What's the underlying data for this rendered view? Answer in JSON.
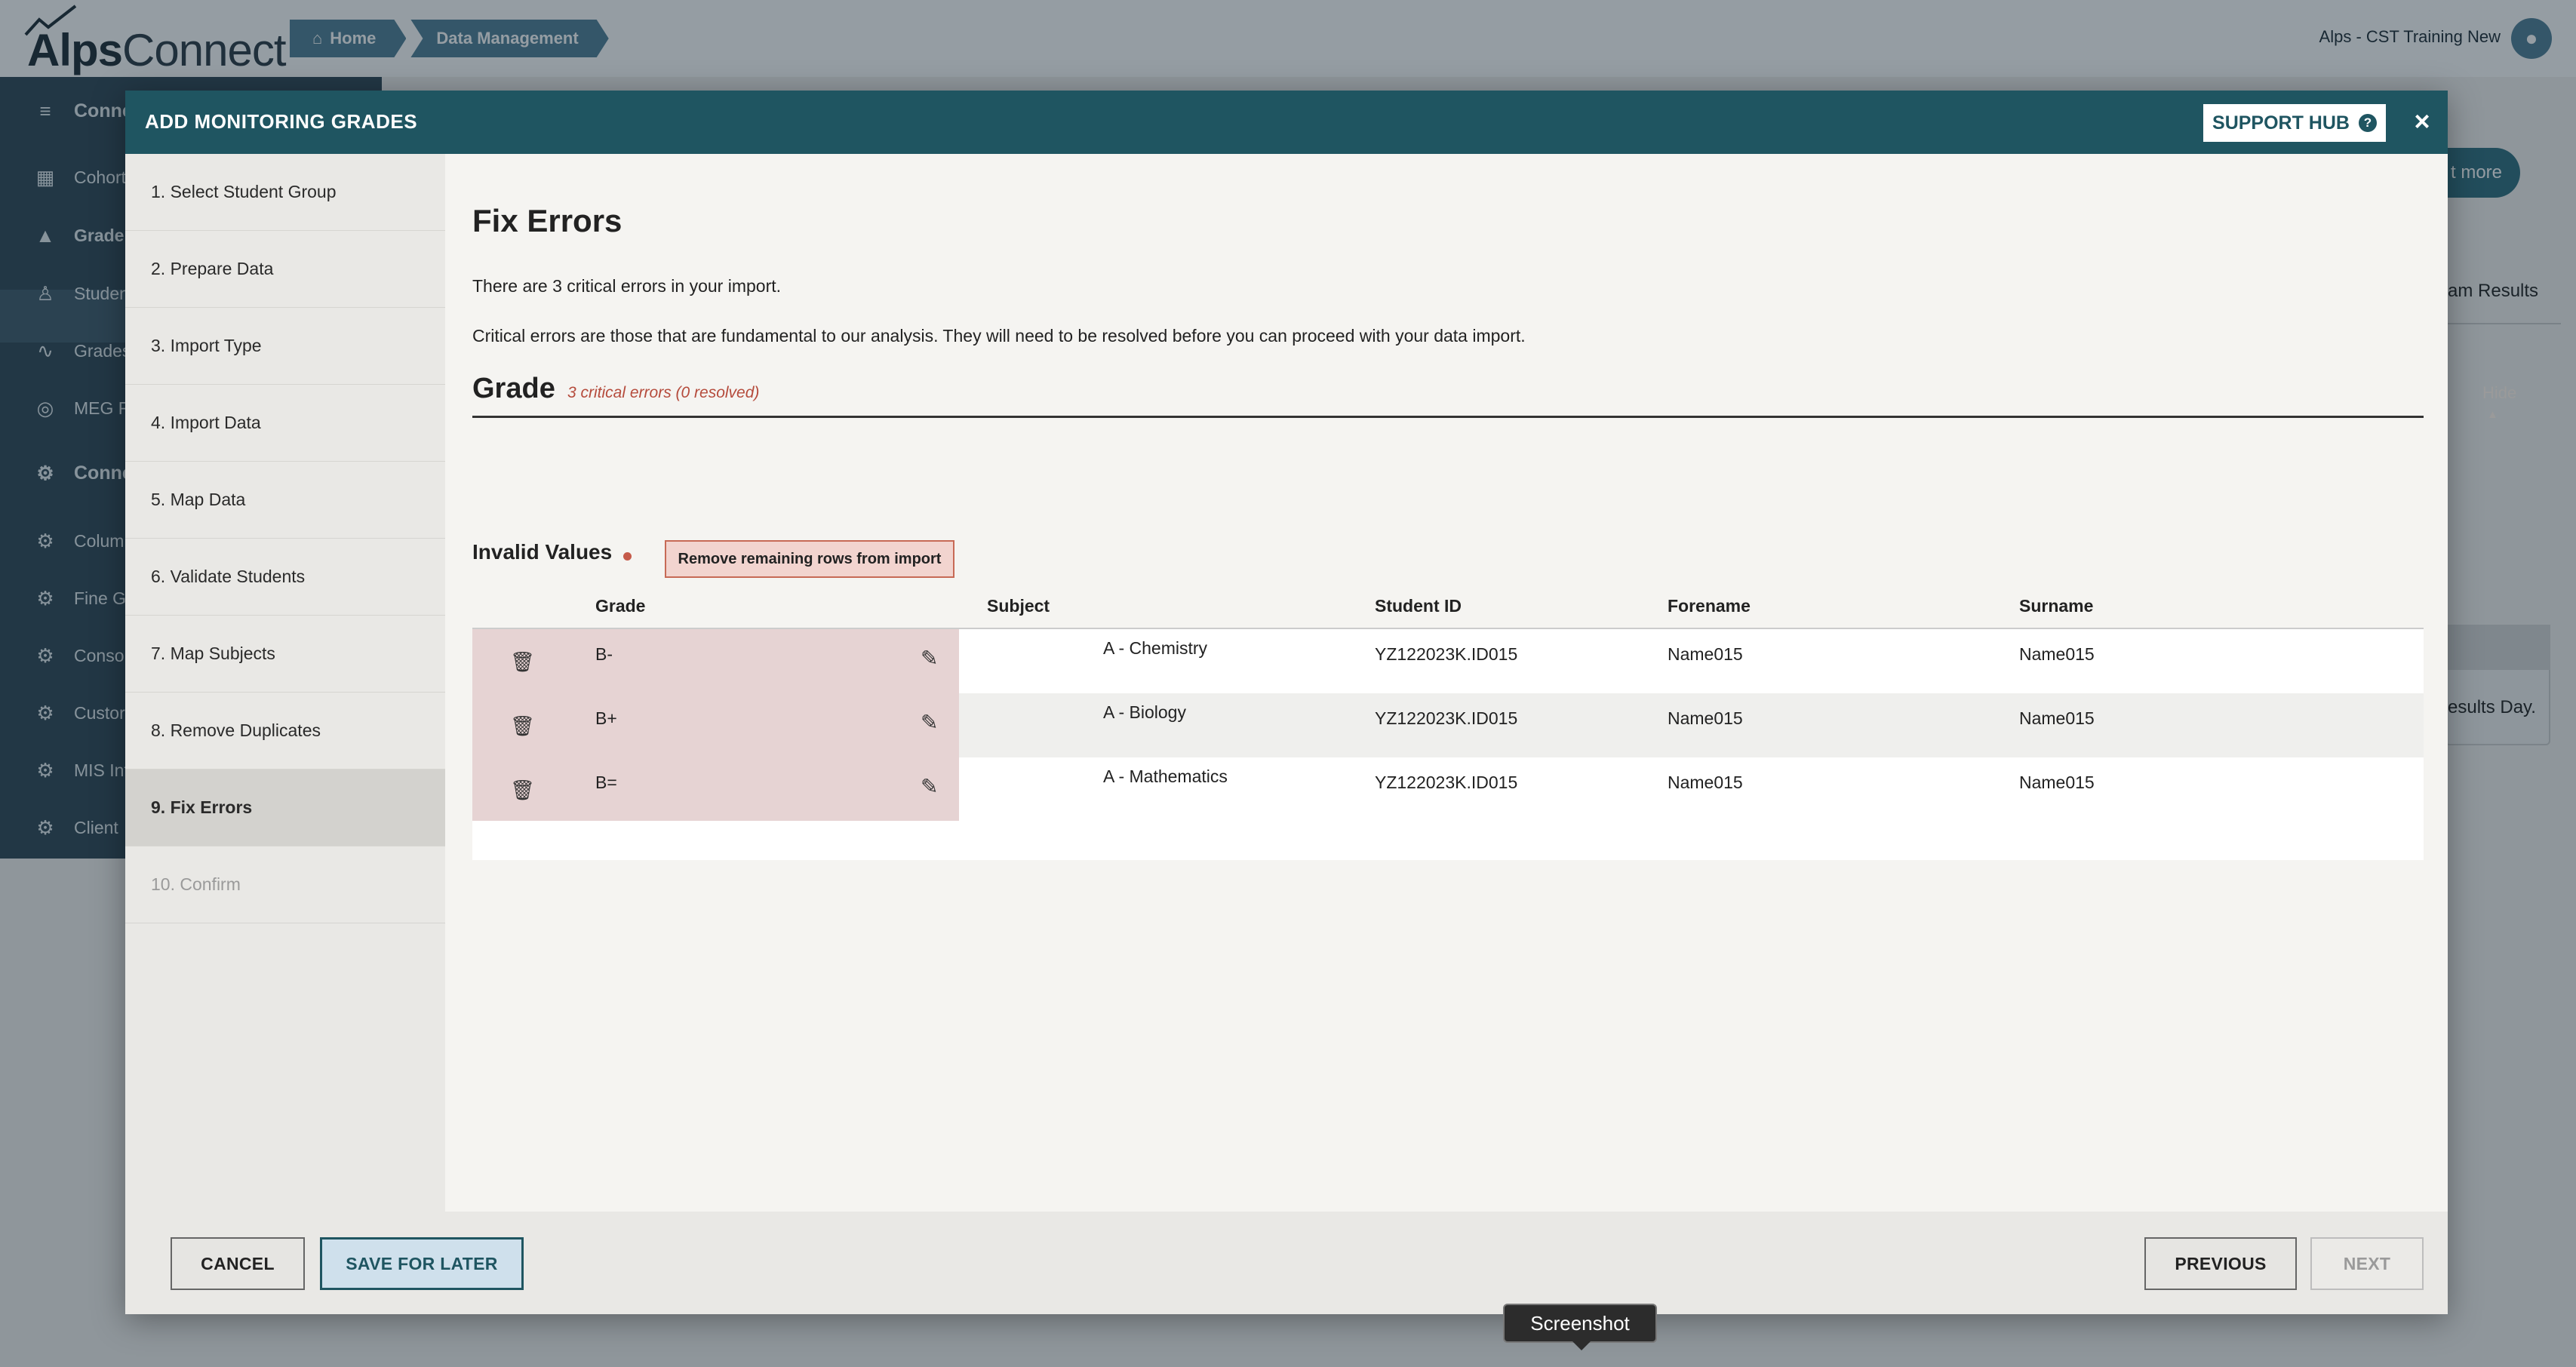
{
  "app": {
    "logo_bold": "Alps",
    "logo_rest": "Connect",
    "breadcrumbs": [
      "Home",
      "Data Management"
    ],
    "org_name": "Alps - CST Training New",
    "sidebar": [
      {
        "label": "Conne",
        "icon": "database-icon",
        "head": true
      },
      {
        "label": "Cohort",
        "icon": "table-icon"
      },
      {
        "label": "Grade",
        "icon": "graduation-cap-icon",
        "active": true
      },
      {
        "label": "Studen",
        "icon": "student-icon"
      },
      {
        "label": "Grades",
        "icon": "line-chart-icon"
      },
      {
        "label": "MEG R",
        "icon": "target-icon"
      },
      {
        "label": "Conne",
        "icon": "gear-icon",
        "head": true
      },
      {
        "label": "Colum",
        "icon": "gear-icon"
      },
      {
        "label": "Fine G",
        "icon": "gear-icon"
      },
      {
        "label": "Consol",
        "icon": "gear-icon"
      },
      {
        "label": "Custor",
        "icon": "gear-icon"
      },
      {
        "label": "MIS Int",
        "icon": "gear-icon"
      },
      {
        "label": "Client ",
        "icon": "gear-icon"
      }
    ],
    "read_more": "t more",
    "exam_results": "am Results",
    "results_day": "esults Day."
  },
  "modal": {
    "title": "ADD MONITORING GRADES",
    "support_hub": "SUPPORT HUB",
    "close": "×",
    "steps": [
      {
        "label": "1. Select Student Group",
        "state": "done"
      },
      {
        "label": "2. Prepare Data",
        "state": "done"
      },
      {
        "label": "3. Import Type",
        "state": "done"
      },
      {
        "label": "4. Import Data",
        "state": "done"
      },
      {
        "label": "5. Map Data",
        "state": "done"
      },
      {
        "label": "6. Validate Students",
        "state": "done"
      },
      {
        "label": "7. Map Subjects",
        "state": "done"
      },
      {
        "label": "8. Remove Duplicates",
        "state": "done"
      },
      {
        "label": "9. Fix Errors",
        "state": "active"
      },
      {
        "label": "10. Confirm",
        "state": "disabled"
      }
    ],
    "content": {
      "title": "Fix Errors",
      "intro": "There are 3 critical errors in your import.",
      "explanation": "Critical errors are those that are fundamental to our analysis. They will need to be resolved before you can proceed with your data import.",
      "section_title": "Grade",
      "section_status": "3 critical errors (0 resolved)",
      "hide_label": "Hide",
      "invalid_values_label": "Invalid Values",
      "remove_rows_label": "Remove remaining rows from import",
      "table": {
        "headers": [
          "Grade",
          "Subject",
          "Student ID",
          "Forename",
          "Surname"
        ],
        "rows": [
          {
            "grade": "B-",
            "subject": "A - Chemistry",
            "student_id": "YZ122023K.ID015",
            "forename": "Name015",
            "surname": "Name015"
          },
          {
            "grade": "B+",
            "subject": "A - Biology",
            "student_id": "YZ122023K.ID015",
            "forename": "Name015",
            "surname": "Name015"
          },
          {
            "grade": "B=",
            "subject": "A - Mathematics",
            "student_id": "YZ122023K.ID015",
            "forename": "Name015",
            "surname": "Name015"
          }
        ]
      }
    },
    "footer": {
      "cancel": "CANCEL",
      "save_for_later": "SAVE FOR LATER",
      "previous": "PREVIOUS",
      "next": "NEXT"
    }
  },
  "tooltip": "Screenshot"
}
